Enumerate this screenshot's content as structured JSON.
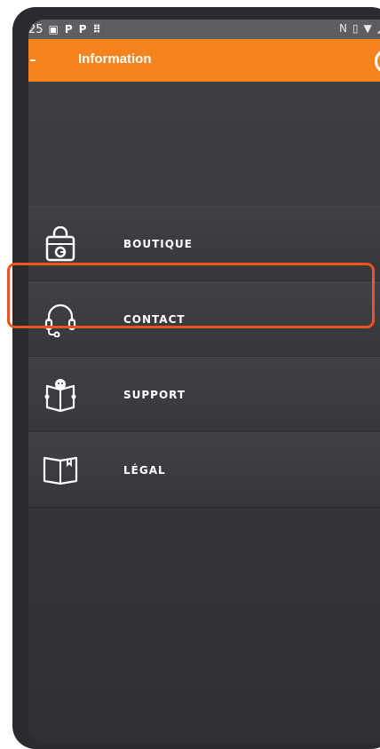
{
  "status_bar": {
    "time": "25",
    "icons": [
      "image-icon",
      "p-icon",
      "p-icon",
      "grid-icon"
    ],
    "right_icons": [
      "nfc-icon",
      "vibrate-icon",
      "wifi-icon",
      "signal-icon"
    ]
  },
  "app_bar": {
    "title": "Information",
    "background_color": "#f5841f"
  },
  "menu": {
    "items": [
      {
        "label": "BOUTIQUE",
        "icon": "shopping-bag-icon"
      },
      {
        "label": "CONTACT",
        "icon": "headset-icon",
        "highlighted": true
      },
      {
        "label": "SUPPORT",
        "icon": "support-book-icon"
      },
      {
        "label": "LÉGAL",
        "icon": "open-book-icon"
      }
    ]
  },
  "highlight_color": "#f0531c"
}
